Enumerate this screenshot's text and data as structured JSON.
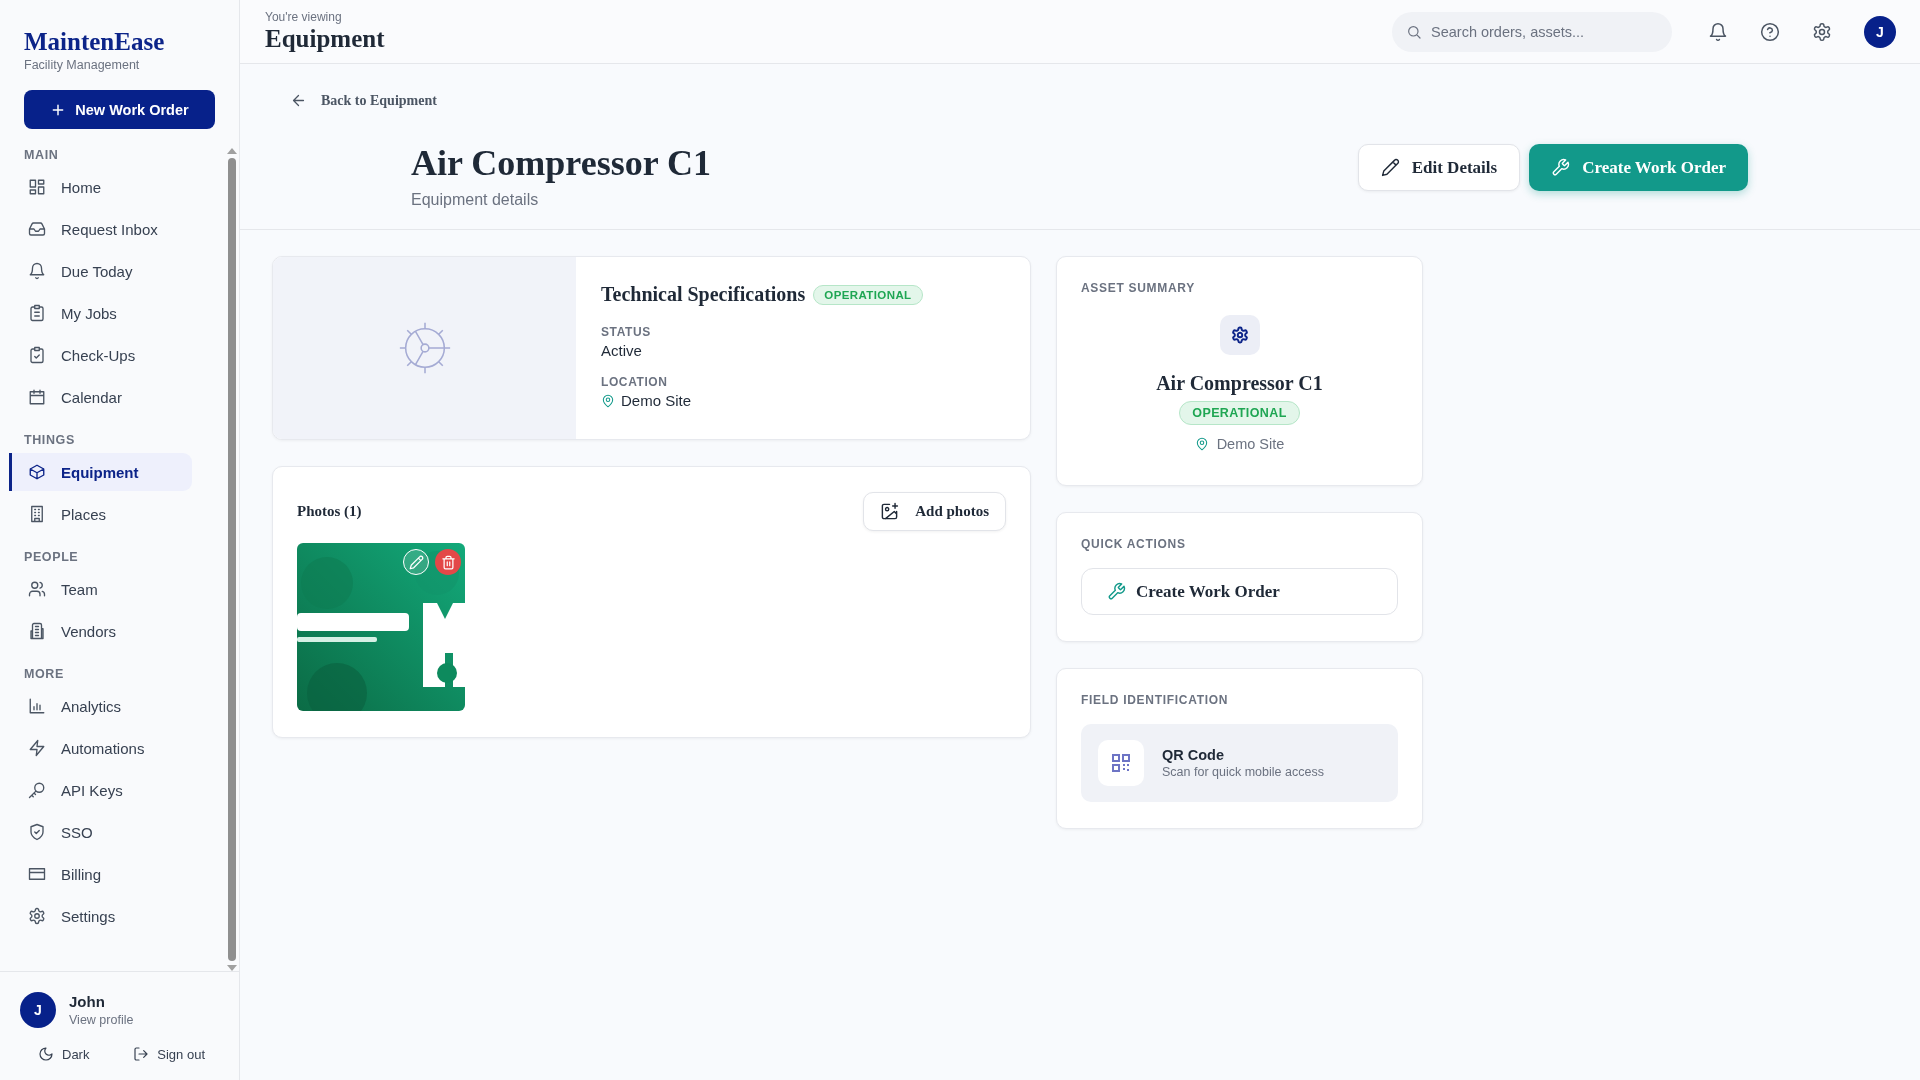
{
  "brand": {
    "name": "MaintenEase",
    "tagline": "Facility Management"
  },
  "new_button": {
    "label": "New Work Order"
  },
  "sidebar": {
    "sections": [
      {
        "title": "MAIN",
        "items": [
          {
            "label": "Home",
            "selected": false
          },
          {
            "label": "Request Inbox",
            "selected": false
          },
          {
            "label": "Due Today",
            "selected": false
          },
          {
            "label": "My Jobs",
            "selected": false
          },
          {
            "label": "Check-Ups",
            "selected": false
          },
          {
            "label": "Calendar",
            "selected": false
          }
        ]
      },
      {
        "title": "THINGS",
        "items": [
          {
            "label": "Equipment",
            "selected": true
          },
          {
            "label": "Places",
            "selected": false
          }
        ]
      },
      {
        "title": "PEOPLE",
        "items": [
          {
            "label": "Team",
            "selected": false
          },
          {
            "label": "Vendors",
            "selected": false
          }
        ]
      },
      {
        "title": "MORE",
        "items": [
          {
            "label": "Analytics",
            "selected": false
          },
          {
            "label": "Automations",
            "selected": false
          },
          {
            "label": "API Keys",
            "selected": false
          },
          {
            "label": "SSO",
            "selected": false
          },
          {
            "label": "Billing",
            "selected": false
          },
          {
            "label": "Settings",
            "selected": false
          }
        ]
      }
    ]
  },
  "user": {
    "initial": "J",
    "name": "John",
    "link": "View profile"
  },
  "footer_actions": [
    {
      "label": "Dark"
    },
    {
      "label": "Sign out"
    }
  ],
  "header": {
    "eyebrow": "You're viewing",
    "title": "Equipment",
    "search": {
      "placeholder": "Search orders, assets..."
    },
    "avatar": "J"
  },
  "back_link": "Back to Equipment",
  "page": {
    "title": "Air Compressor C1",
    "subtitle": "Equipment details",
    "actions": [
      {
        "label": "Edit Details",
        "kind": "edit"
      },
      {
        "label": "Create Work Order",
        "kind": "create"
      }
    ]
  },
  "specs": {
    "title": "Technical Specifications",
    "badge": "OPERATIONAL",
    "fields": [
      {
        "label": "STATUS",
        "value": "Active",
        "kind": "text"
      },
      {
        "label": "LOCATION",
        "value": "Demo Site",
        "kind": "location"
      }
    ]
  },
  "photos": {
    "title": "Photos (1)",
    "add_label": "Add photos"
  },
  "summary": {
    "heading": "ASSET SUMMARY",
    "name": "Air Compressor C1",
    "badge": "OPERATIONAL",
    "location": "Demo Site"
  },
  "quick_actions": {
    "heading": "QUICK ACTIONS",
    "button": "Create Work Order"
  },
  "field_identification": {
    "heading": "FIELD IDENTIFICATION",
    "title": "QR Code",
    "description": "Scan for quick mobile access"
  }
}
